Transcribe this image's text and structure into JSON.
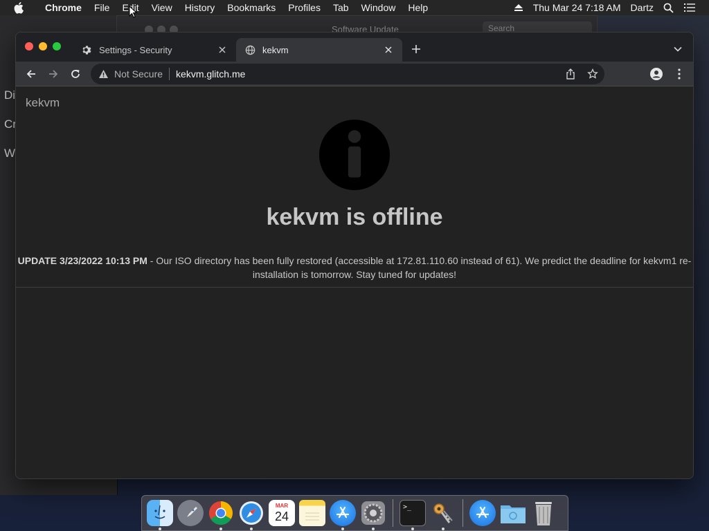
{
  "menubar": {
    "app_name": "Chrome",
    "menus": [
      "File",
      "Edit",
      "View",
      "History",
      "Bookmarks",
      "Profiles",
      "Tab",
      "Window",
      "Help"
    ],
    "datetime": "Thu Mar 24  7:18 AM",
    "user": "Dartz"
  },
  "background_windows": {
    "software_update_title": "Software Update",
    "search_placeholder": "Search",
    "left_fragments": [
      "Di",
      "Cr",
      "W"
    ]
  },
  "browser": {
    "tabs": [
      {
        "title": "Settings - Security",
        "icon": "gear-icon",
        "active": false
      },
      {
        "title": "kekvm",
        "icon": "globe-icon",
        "active": true
      }
    ],
    "omnibox": {
      "security_label": "Not Secure",
      "url": "kekvm.glitch.me"
    }
  },
  "page": {
    "site_name": "kekvm",
    "headline": "kekvm is offline",
    "update_prefix": "UPDATE 3/23/2022 10:13 PM",
    "update_text": " - Our ISO directory has been fully restored (accessible at 172.81.110.60 instead of 61). We predict the deadline for kekvm1 re-installation is tomorrow. Stay tuned for updates!"
  },
  "dock": {
    "calendar_month": "MAR",
    "calendar_day": "24",
    "apps": [
      "finder-icon",
      "launchpad-icon",
      "chrome-icon",
      "safari-icon",
      "calendar-icon",
      "notes-icon",
      "app-store-icon",
      "system-preferences-icon",
      "terminal-icon",
      "keychain-icon",
      "app-store-folder-icon",
      "downloads-folder-icon",
      "trash-icon"
    ]
  },
  "colors": {
    "close": "#ff5f57",
    "minimize": "#febc2e",
    "zoom": "#28c840"
  }
}
